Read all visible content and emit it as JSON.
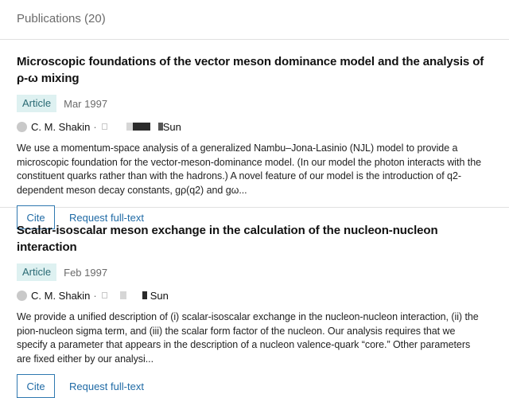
{
  "section": {
    "title": "Publications (20)"
  },
  "publications": [
    {
      "title": "Microscopic foundations of the vector meson dominance model and the analysis of ρ-ω mixing",
      "type": "Article",
      "date": "Mar 1997",
      "author_1": "C. M. Shakin",
      "separator": "·",
      "author_2_visible": "Sun",
      "abstract": "We use a momentum-space analysis of a generalized Nambu–Jona-Lasinio (NJL) model to provide a microscopic foundation for the vector-meson-dominance model. (In our model the photon interacts with the constituent quarks rather than with the hadrons.) A novel feature of our model is the introduction of q2-dependent meson decay constants, gρ(q2) and gω...",
      "cite_label": "Cite",
      "request_label": "Request full-text"
    },
    {
      "title": "Scalar-isoscalar meson exchange in the calculation of the nucleon-nucleon interaction",
      "type": "Article",
      "date": "Feb 1997",
      "author_1": "C. M. Shakin",
      "separator": "·",
      "author_2_visible": "Sun",
      "abstract": "We provide a unified description of (i) scalar-isoscalar exchange in the nucleon-nucleon interaction, (ii) the pion-nucleon sigma term, and (iii) the scalar form factor of the nucleon. Our analysis requires that we specify a parameter that appears in the description of a nucleon valence-quark “core.” Other parameters are fixed either by our analysi...",
      "cite_label": "Cite",
      "request_label": "Request full-text"
    }
  ],
  "colors": {
    "accent_link": "#1f6aa5",
    "badge_bg": "#def1f1",
    "badge_text": "#2a6a74",
    "muted": "#6b6b6b",
    "divider": "#e1e1e1"
  }
}
